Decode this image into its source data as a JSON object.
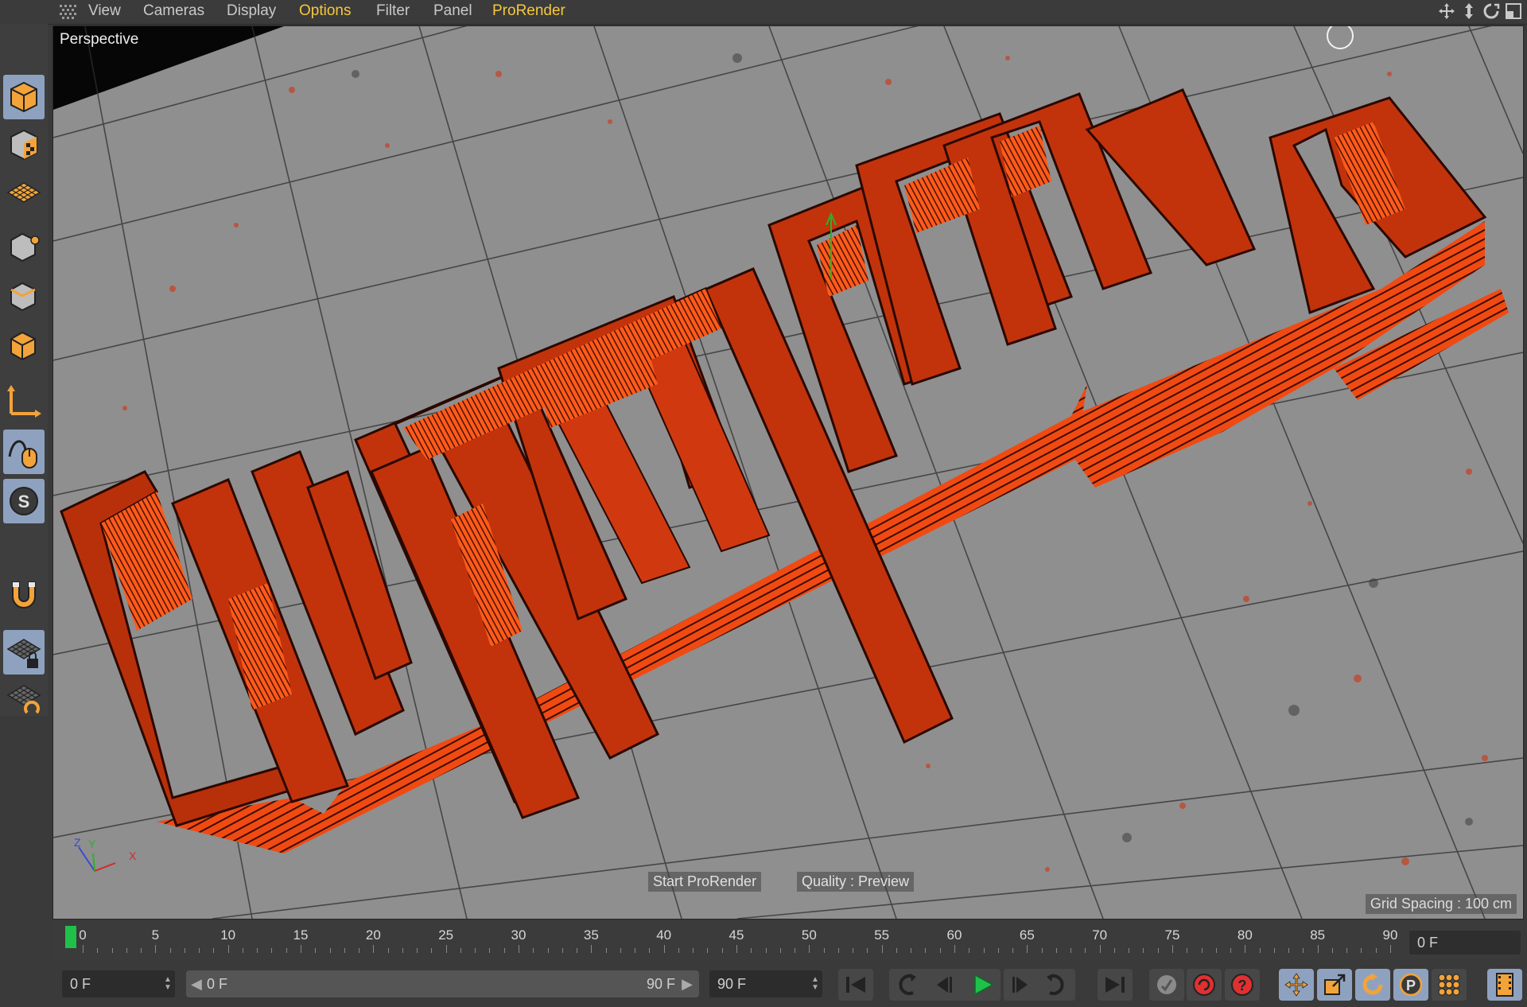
{
  "menu": {
    "items": [
      "View",
      "Cameras",
      "Display",
      "Options",
      "Filter",
      "Panel",
      "ProRender"
    ],
    "highlighted": [
      "Options",
      "ProRender"
    ]
  },
  "viewport": {
    "label": "Perspective",
    "start_prorender": "Start ProRender",
    "quality": "Quality : Preview",
    "grid_spacing": "Grid Spacing : 100 cm",
    "axis_labels": {
      "z": "Z",
      "y": "Y",
      "x": "X"
    }
  },
  "timeline": {
    "ticks": [
      "0",
      "5",
      "10",
      "15",
      "20",
      "25",
      "30",
      "35",
      "40",
      "45",
      "50",
      "55",
      "60",
      "65",
      "70",
      "75",
      "80",
      "85",
      "90"
    ],
    "current_frame": "0 F"
  },
  "bottom": {
    "start_field": "0 F",
    "range_start": "0 F",
    "range_end": "90 F",
    "end_field": "90 F"
  },
  "colors": {
    "accent": "#f6c83c",
    "object": "#ff4a12",
    "tool_active": "#8ea2c0",
    "play": "#20c14a"
  },
  "icons": {
    "toolbar": [
      "model-mode-icon",
      "texture-mode-icon",
      "workplane-icon",
      "points-mode-icon",
      "edges-mode-icon",
      "polygons-mode-icon",
      "axis-mode-icon",
      "tweak-mode-icon",
      "solo-icon",
      "snap-magnet-icon",
      "lock-workplane-icon",
      "workplane-alignment-icon"
    ],
    "transport": [
      "goto-start-icon",
      "prev-key-icon",
      "prev-frame-icon",
      "play-icon",
      "next-frame-icon",
      "next-key-icon",
      "goto-end-icon"
    ],
    "right": [
      "record-key-icon",
      "autokey-icon",
      "keyframe-selection-icon",
      "move-key-icon",
      "scale-key-icon",
      "rotate-key-icon",
      "param-key-icon",
      "pla-key-icon",
      "timeline-icon"
    ]
  }
}
